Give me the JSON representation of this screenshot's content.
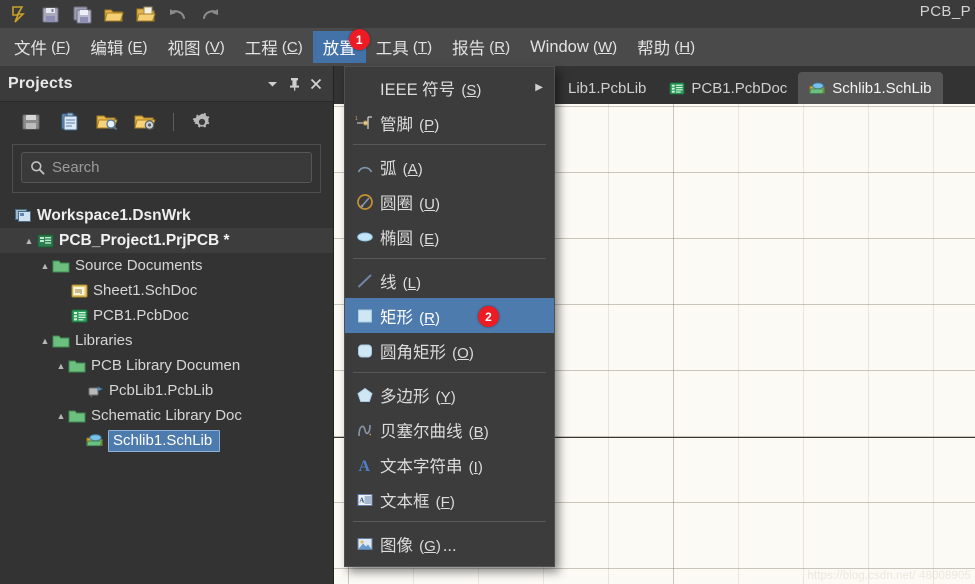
{
  "window": {
    "title_right": "PCB_P"
  },
  "quick_access": {
    "buttons": [
      {
        "name": "altium-logo-icon",
        "label": ""
      },
      {
        "name": "save-icon",
        "label": ""
      },
      {
        "name": "save-all-icon",
        "label": ""
      },
      {
        "name": "open-folder-icon",
        "label": ""
      },
      {
        "name": "open-document-icon",
        "label": ""
      },
      {
        "name": "undo-icon",
        "label": ""
      },
      {
        "name": "redo-icon",
        "label": ""
      }
    ]
  },
  "menubar": {
    "items": [
      {
        "label": "文件",
        "mnemonic": "F",
        "active": false
      },
      {
        "label": "编辑",
        "mnemonic": "E",
        "active": false
      },
      {
        "label": "视图",
        "mnemonic": "V",
        "active": false
      },
      {
        "label": "工程",
        "mnemonic": "C",
        "active": false
      },
      {
        "label": "放置",
        "mnemonic": "",
        "active": true,
        "badge": "1"
      },
      {
        "label": "工具",
        "mnemonic": "T",
        "active": false
      },
      {
        "label": "报告",
        "mnemonic": "R",
        "active": false
      },
      {
        "label": "Window",
        "mnemonic": "W",
        "active": false
      },
      {
        "label": "帮助",
        "mnemonic": "H",
        "active": false
      }
    ]
  },
  "place_menu": {
    "items": [
      {
        "label": "IEEE 符号",
        "mnemonic": "S",
        "icon": "",
        "submenu": true,
        "selected": false
      },
      {
        "label": "管脚",
        "mnemonic": "P",
        "icon": "pin-icon",
        "submenu": false,
        "selected": false
      },
      {
        "separator": true
      },
      {
        "label": "弧",
        "mnemonic": "A",
        "icon": "arc-icon",
        "submenu": false,
        "selected": false
      },
      {
        "label": "圆圈",
        "mnemonic": "U",
        "icon": "circle-icon",
        "submenu": false,
        "selected": false
      },
      {
        "label": "椭圆",
        "mnemonic": "E",
        "icon": "ellipse-icon",
        "submenu": false,
        "selected": false
      },
      {
        "separator": true
      },
      {
        "label": "线",
        "mnemonic": "L",
        "icon": "line-icon",
        "submenu": false,
        "selected": false
      },
      {
        "label": "矩形",
        "mnemonic": "R",
        "icon": "rectangle-icon",
        "submenu": false,
        "selected": true,
        "badge": "2"
      },
      {
        "label": "圆角矩形",
        "mnemonic": "O",
        "icon": "rounded-rectangle-icon",
        "submenu": false,
        "selected": false
      },
      {
        "separator": true
      },
      {
        "label": "多边形",
        "mnemonic": "Y",
        "icon": "polygon-icon",
        "submenu": false,
        "selected": false
      },
      {
        "label": "贝塞尔曲线",
        "mnemonic": "B",
        "icon": "bezier-curve-icon",
        "submenu": false,
        "selected": false
      },
      {
        "label": "文本字符串",
        "mnemonic": "I",
        "icon": "text-string-icon",
        "submenu": false,
        "selected": false
      },
      {
        "label": "文本框",
        "mnemonic": "F",
        "icon": "text-frame-icon",
        "submenu": false,
        "selected": false
      },
      {
        "separator": true
      },
      {
        "label": "图像",
        "mnemonic": "G",
        "suffix": "...",
        "icon": "image-icon",
        "submenu": false,
        "selected": false
      }
    ]
  },
  "projects_panel": {
    "title": "Projects",
    "header_buttons": [
      {
        "name": "panel-dropdown-button",
        "glyph": "▼"
      },
      {
        "name": "panel-pin-button",
        "glyph": "📌"
      },
      {
        "name": "panel-close-button",
        "glyph": "✕"
      }
    ],
    "toolbar_buttons": [
      {
        "name": "save-project-icon"
      },
      {
        "name": "clipboard-icon"
      },
      {
        "name": "open-project-search-icon"
      },
      {
        "name": "project-options-folder-icon"
      },
      {
        "name": "settings-gear-icon"
      }
    ],
    "search": {
      "placeholder": "Search",
      "value": "",
      "icon": "search-icon"
    },
    "tree": [
      {
        "label": "Workspace1.DsnWrk",
        "indent": 0,
        "twisty": "",
        "icon": "workspace-icon",
        "style": "workspace"
      },
      {
        "label": "PCB_Project1.PrjPCB *",
        "indent": 1,
        "twisty": "▲",
        "icon": "project-icon",
        "style": "project"
      },
      {
        "label": "Source Documents",
        "indent": 2,
        "twisty": "▲",
        "icon": "folder-icon",
        "style": ""
      },
      {
        "label": "Sheet1.SchDoc",
        "indent": 4,
        "twisty": "",
        "icon": "schdoc-icon",
        "style": ""
      },
      {
        "label": "PCB1.PcbDoc",
        "indent": 4,
        "twisty": "",
        "icon": "pcbdoc-icon",
        "style": ""
      },
      {
        "label": "Libraries",
        "indent": 2,
        "twisty": "▲",
        "icon": "folder-icon",
        "style": ""
      },
      {
        "label": "PCB Library Documen",
        "indent": 3,
        "twisty": "▲",
        "icon": "folder-icon",
        "style": ""
      },
      {
        "label": "PcbLib1.PcbLib",
        "indent": 5,
        "twisty": "",
        "icon": "pcblib-icon",
        "style": ""
      },
      {
        "label": "Schematic Library Doc",
        "indent": 3,
        "twisty": "▲",
        "icon": "folder-icon",
        "style": ""
      },
      {
        "label": "Schlib1.SchLib",
        "indent": 5,
        "twisty": "",
        "icon": "schlib-icon",
        "style": "selected"
      }
    ]
  },
  "document_tabs": [
    {
      "label": "Lib1.PcbLib",
      "icon": "pcblib-icon",
      "active": false
    },
    {
      "label": "PCB1.PcbDoc",
      "icon": "pcbdoc-icon",
      "active": false
    },
    {
      "label": "Schlib1.SchLib",
      "icon": "schlib-icon",
      "active": true
    }
  ],
  "canvas": {
    "watermark": "https://blog.csdn.net/ 48008905"
  }
}
